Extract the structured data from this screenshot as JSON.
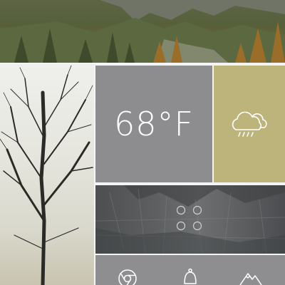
{
  "tiles": {
    "temperature": "68°F"
  },
  "icons": {
    "weather": "cloud-rain-icon",
    "grid": "four-dots-grid-icon",
    "browser": "chrome-icon",
    "notifications": "bell-icon",
    "photos": "mountain-icon"
  },
  "colors": {
    "temperature_tile": "#8d8d8f",
    "weather_tile": "#bcb47b",
    "app_row": "#8e8e90"
  }
}
